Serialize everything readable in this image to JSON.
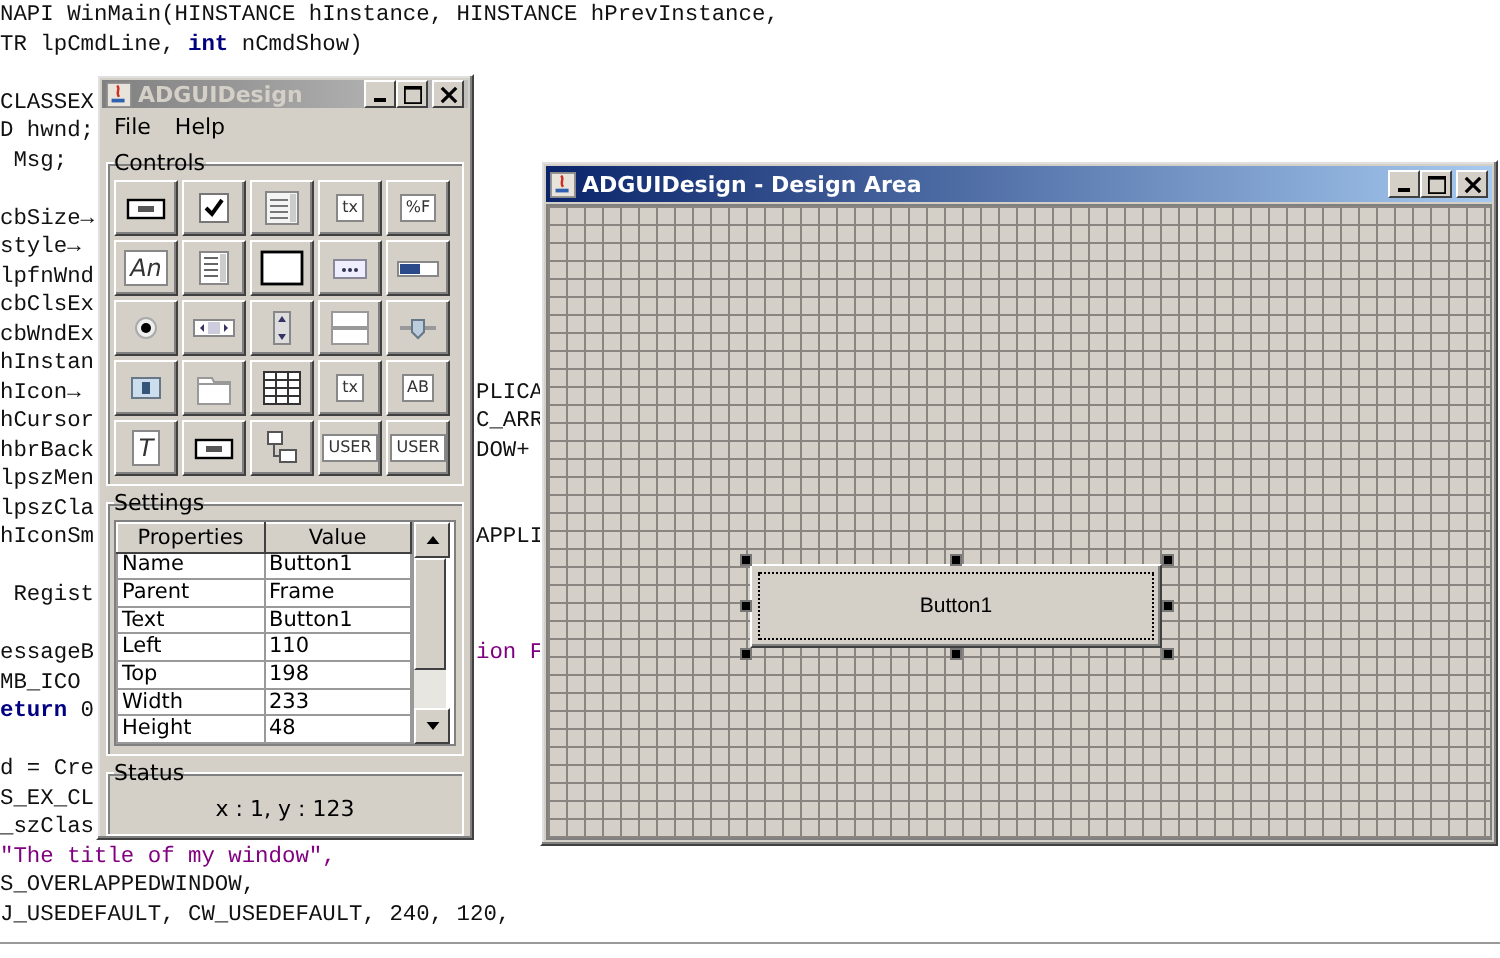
{
  "code_editor": {
    "lines": [
      {
        "kind": "code",
        "text": "NAPI WinMain(HINSTANCE hInstance, HINSTANCE hPrevInstance,"
      },
      {
        "kind": "code",
        "text": "TR lpCmdLine, **int** nCmdShow)"
      },
      {
        "kind": "blank"
      },
      {
        "kind": "code",
        "text": "CLASSEX"
      },
      {
        "kind": "code",
        "text": "D hwnd;"
      },
      {
        "kind": "code",
        "text": " Msg;"
      },
      {
        "kind": "blank"
      },
      {
        "kind": "code",
        "text": "cbSize→"
      },
      {
        "kind": "code",
        "text": "style→"
      },
      {
        "kind": "code",
        "text": "lpfnWnd"
      },
      {
        "kind": "code",
        "text": "cbClsEx"
      },
      {
        "kind": "code",
        "text": "cbWndEx"
      },
      {
        "kind": "code",
        "text": "hInstan"
      },
      {
        "kind": "code",
        "text": "hIcon→",
        "tail": "PLICA"
      },
      {
        "kind": "code",
        "text": "hCursor",
        "tail": "C_ARR"
      },
      {
        "kind": "code",
        "text": "hbrBack",
        "tail": "DOW+"
      },
      {
        "kind": "code",
        "text": "lpszMen"
      },
      {
        "kind": "code",
        "text": "lpszCla"
      },
      {
        "kind": "code",
        "text": "hIconSm",
        "tail": "APPLI"
      },
      {
        "kind": "blank"
      },
      {
        "kind": "code",
        "text": " Regist"
      },
      {
        "kind": "blank"
      },
      {
        "kind": "code",
        "text": "essageB",
        "tail": "ion F",
        "tail_string": true
      },
      {
        "kind": "code",
        "text": "MB_ICO"
      },
      {
        "kind": "code",
        "text": "**eturn** 0"
      },
      {
        "kind": "blank"
      },
      {
        "kind": "code",
        "text": "d = Cre"
      },
      {
        "kind": "code",
        "text": "S_EX_CL"
      },
      {
        "kind": "code",
        "text": "_szClas"
      },
      {
        "kind": "string",
        "text": "\"The title of my window\","
      },
      {
        "kind": "code",
        "text": "S_OVERLAPPEDWINDOW,"
      },
      {
        "kind": "code",
        "text": "J_USEDEFAULT, CW_USEDEFAULT, 240, 120,"
      }
    ]
  },
  "tool_window": {
    "title": "ADGUIDesign",
    "active": false,
    "menu": [
      "File",
      "Help"
    ],
    "controls": {
      "title": "Controls",
      "items": [
        {
          "kind": "button"
        },
        {
          "kind": "checkbox"
        },
        {
          "kind": "list"
        },
        {
          "kind": "textfield",
          "glyph": "tx"
        },
        {
          "kind": "formatted",
          "glyph": "%F"
        },
        {
          "kind": "label",
          "glyph": "An"
        },
        {
          "kind": "textarea"
        },
        {
          "kind": "panel"
        },
        {
          "kind": "ellipsis"
        },
        {
          "kind": "progress"
        },
        {
          "kind": "radio"
        },
        {
          "kind": "scrollbar"
        },
        {
          "kind": "spinner"
        },
        {
          "kind": "splitpane"
        },
        {
          "kind": "slider"
        },
        {
          "kind": "toggle"
        },
        {
          "kind": "tabs"
        },
        {
          "kind": "table"
        },
        {
          "kind": "textfield",
          "glyph": "tx"
        },
        {
          "kind": "textfield",
          "glyph": "AB"
        },
        {
          "kind": "label",
          "glyph": "T"
        },
        {
          "kind": "button"
        },
        {
          "kind": "tree"
        },
        {
          "kind": "custom",
          "glyph": "USER"
        },
        {
          "kind": "custom",
          "glyph": "USER"
        }
      ]
    },
    "settings": {
      "title": "Settings",
      "columns": [
        "Properties",
        "Value"
      ],
      "rows": [
        [
          "Name",
          "Button1"
        ],
        [
          "Parent",
          "Frame"
        ],
        [
          "Text",
          "Button1"
        ],
        [
          "Left",
          "110"
        ],
        [
          "Top",
          "198"
        ],
        [
          "Width",
          "233"
        ],
        [
          "Height",
          "48"
        ]
      ]
    },
    "status": {
      "title": "Status",
      "text": "x : 1, y : 123"
    }
  },
  "design_window": {
    "title": "ADGUIDesign - Design Area",
    "active": true,
    "components": [
      {
        "kind": "button",
        "text": "Button1",
        "selected": true
      }
    ]
  }
}
